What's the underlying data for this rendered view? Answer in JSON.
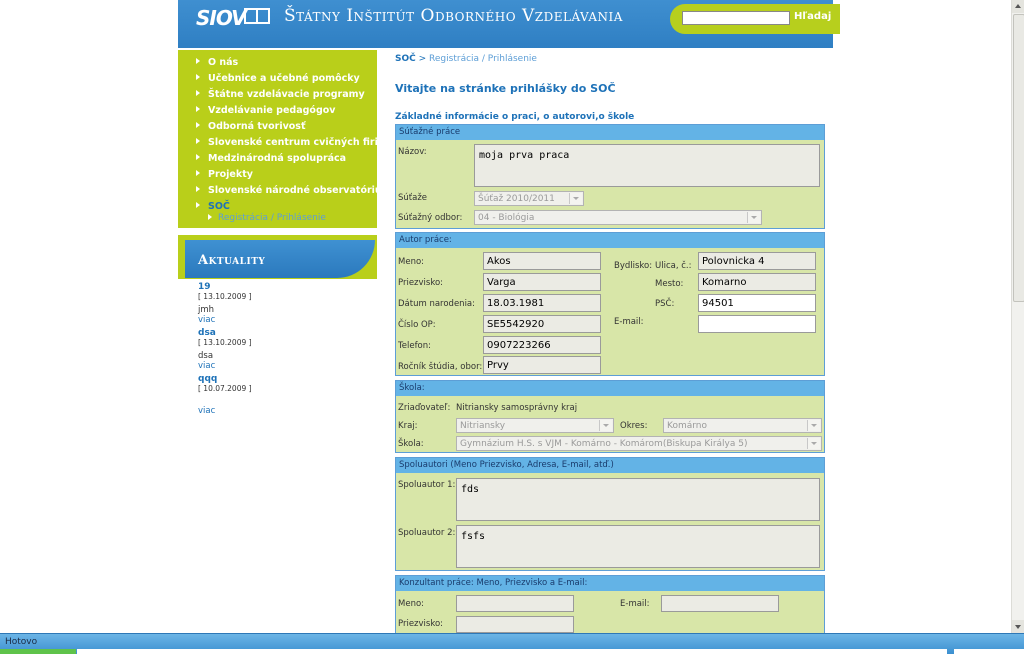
{
  "header": {
    "logo": "SIOV",
    "title": "Štátny Inštitút Odborného Vzdelávania",
    "search_placeholder": "",
    "search_button": "Hľadaj"
  },
  "nav": {
    "items": [
      "O nás",
      "Učebnice a učebné pomôcky",
      "Štátne vzdelávacie programy",
      "Vzdelávanie pedagógov",
      "Odborná tvorivosť",
      "Slovenské centrum cvičných firiem",
      "Medzinárodná spolupráca",
      "Projekty",
      "Slovenské národné observatórium",
      "SOČ"
    ],
    "subitem": "Registrácia / Prihlásenie"
  },
  "news": {
    "title": "Aktuality",
    "entries": [
      {
        "title": "19",
        "date": "[ 13.10.2009 ]",
        "body": "jmh",
        "more": "viac"
      },
      {
        "title": "dsa",
        "date": "[ 13.10.2009 ]",
        "body": "dsa",
        "more": "viac"
      },
      {
        "title": "qqq",
        "date": "[ 10.07.2009 ]",
        "body": "",
        "more": ""
      }
    ],
    "more": "viac"
  },
  "breadcrumb": {
    "home": "SOČ",
    "sep": ">",
    "current": "Registrácia / Prihlásenie"
  },
  "page_title": "Vitajte na stránke prihlášky do SOČ",
  "section_intro": "Základné informácie o praci, o autorovi,o škole",
  "competition": {
    "legend": "Súťažné práce",
    "name_label": "Názov:",
    "name_value": "moja prva praca",
    "contest_label": "Súťaže",
    "contest_value": "Šúťaž 2010/2011",
    "field_label": "Súťažný odbor:",
    "field_value": "04 - Biológia"
  },
  "author": {
    "legend": "Autor práce:",
    "first_name_label": "Meno:",
    "first_name": "Akos",
    "last_name_label": "Priezvisko:",
    "last_name": "Varga",
    "birth_label": "Dátum narodenia:",
    "birth": "18.03.1981",
    "id_label": "Číslo OP:",
    "id": "SE5542920",
    "phone_label": "Telefon:",
    "phone": "0907223266",
    "year_label": "Ročník štúdia, obor:",
    "year": "Prvy",
    "residence_label": "Bydlisko:",
    "street_label": "Ulica, č.:",
    "street": "Polovnicka 4",
    "city_label": "Mesto:",
    "city": "Komarno",
    "zip_label": "PSČ:",
    "zip": "94501",
    "email_label": "E-mail:",
    "email": ""
  },
  "school": {
    "legend": "Škola:",
    "founder_label": "Zriaďovateľ:",
    "founder": "Nitriansky samosprávny kraj",
    "region_label": "Kraj:",
    "region": "Nitriansky",
    "district_label": "Okres:",
    "district": "Komárno",
    "school_label": "Škola:",
    "school": "Gymnázium H.S. s VJM - Komárno - Komárom(Biskupa Királya 5)"
  },
  "coauthors": {
    "legend": "Spoluautori (Meno Priezvisko, Adresa, E-mail, atď.)",
    "c1_label": "Spoluautor 1:",
    "c1": "fds",
    "c2_label": "Spoluautor 2:",
    "c2": "fsfs"
  },
  "consultant": {
    "legend": "Konzultant práce: Meno, Priezvisko a E-mail:",
    "name_label": "Meno:",
    "surname_label": "Priezvisko:",
    "email_label": "E-mail:"
  },
  "status": {
    "text": "Hotovo"
  },
  "colors": {
    "header_blue": "#2f7fc3",
    "lime": "#b9cf1a",
    "form_bg": "#d8e6a8",
    "legend_blue": "#63b3e6"
  }
}
